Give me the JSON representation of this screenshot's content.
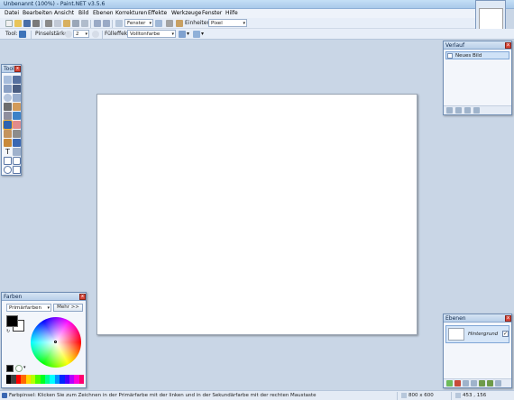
{
  "window": {
    "title": "Unbenannt (100%) - Paint.NET v3.5.6"
  },
  "menu": [
    "Datei",
    "Bearbeiten",
    "Ansicht",
    "Bild",
    "Ebenen",
    "Korrekturen",
    "Effekte",
    "Werkzeuge",
    "Fenster",
    "Hilfe"
  ],
  "toolbar": {
    "zoom_value": "Fenster",
    "units_label": "Einheiten:",
    "units_value": "Pixel"
  },
  "toolbar2": {
    "tool_label": "Tool:",
    "brush_width_label": "Pinselstärke:",
    "brush_width_value": "2",
    "fill_label": "Fülleffekt:",
    "fill_value": "Volltonfarbe"
  },
  "tools_panel": {
    "title": "Tools"
  },
  "history_panel": {
    "title": "Verlauf",
    "items": [
      "Neues Bild"
    ]
  },
  "colors_panel": {
    "title": "Farben",
    "select_value": "Primärfarben",
    "more_button": "Mehr >>"
  },
  "layers_panel": {
    "title": "Ebenen",
    "layers": [
      {
        "name": "Hintergrund",
        "visible": true
      }
    ]
  },
  "status": {
    "message": "Farbpinsel: Klicken Sie zum Zeichnen in der Primärfarbe mit der linken und in der Sekundärfarbe mit der rechten Maustaste",
    "image_size": "800 x 600",
    "cursor_pos": "453 , 156"
  },
  "colors": {
    "primary": "#000000",
    "secondary": "#ffffff",
    "accent": "#3a6fb0"
  }
}
